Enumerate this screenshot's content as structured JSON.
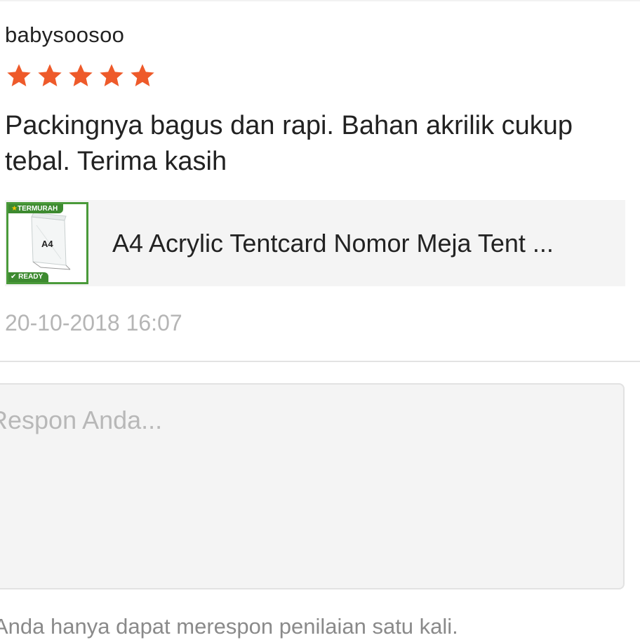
{
  "review": {
    "username": "babysoosoo",
    "rating": 5,
    "max_rating": 5,
    "star_color": "#ee5a2a",
    "comment": "Packingnya bagus dan rapi. Bahan akrilik cukup tebal. Terima kasih",
    "timestamp": "20-10-2018 16:07"
  },
  "product": {
    "title": "A4 Acrylic Tentcard Nomor Meja Tent ...",
    "thumbnail": {
      "ribbon_top": "TERMURAH",
      "ribbon_bottom": "READY",
      "label": "A4"
    }
  },
  "reply": {
    "placeholder": "Respon Anda...",
    "value": ""
  },
  "notice": "Anda hanya dapat merespon penilaian satu kali."
}
